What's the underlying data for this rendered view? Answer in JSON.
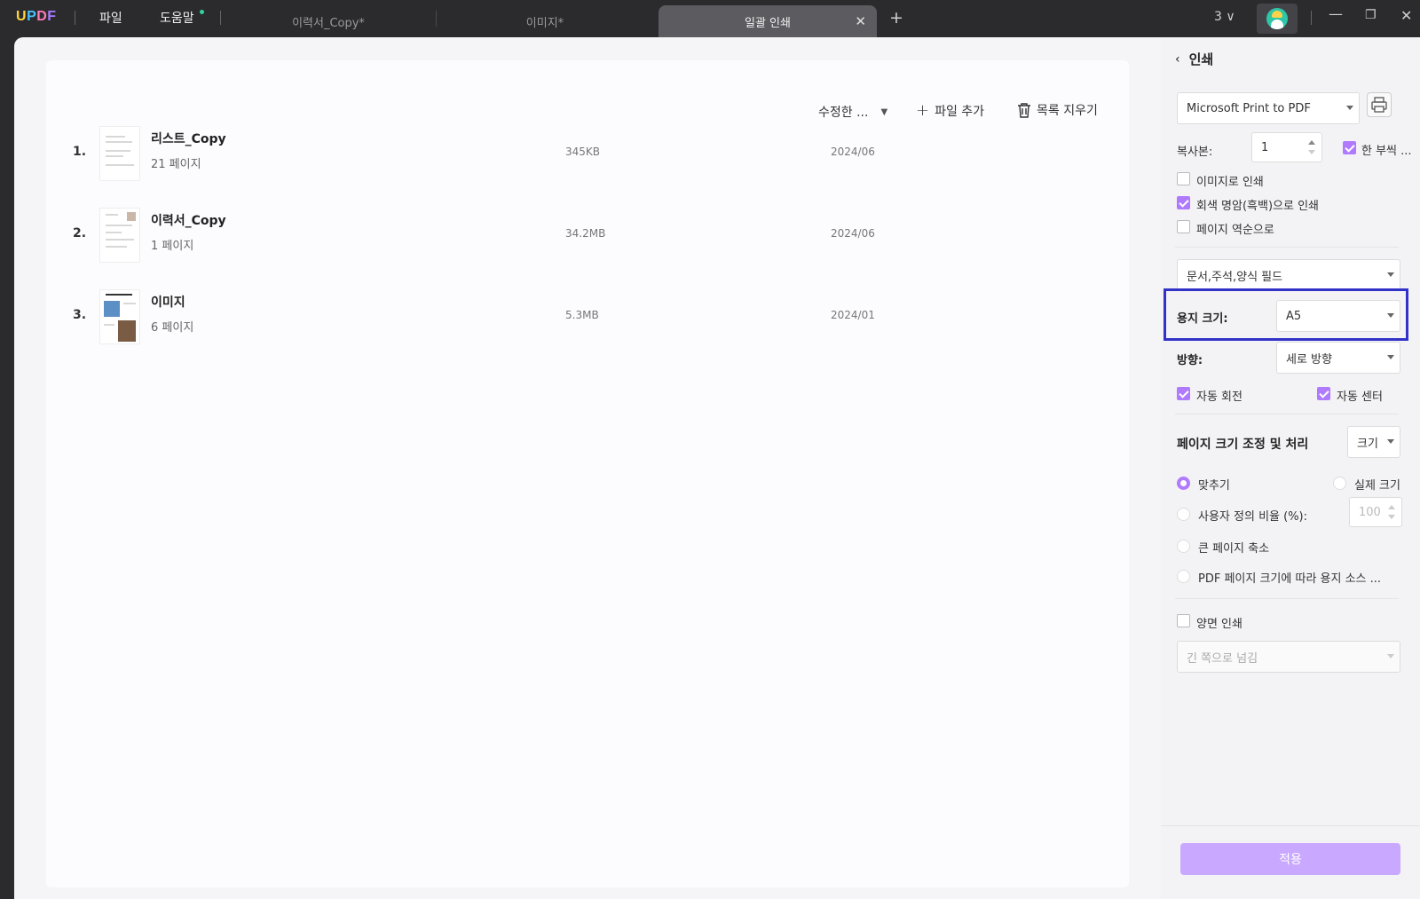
{
  "titlebar": {
    "logo": "UPDF",
    "menu_file": "파일",
    "menu_help": "도움말",
    "tabs": [
      {
        "label": "이력서_Copy*"
      },
      {
        "label": "이미지*"
      },
      {
        "label": "일괄 인쇄"
      }
    ],
    "active_tab_close": "✕",
    "new_tab": "+",
    "account_count": "3"
  },
  "toolbar": {
    "sort_label": "수정한 ...",
    "add_file_label": "파일 추가",
    "clear_list_label": "목록 지우기"
  },
  "files": [
    {
      "index": "1.",
      "name": "리스트_Copy",
      "pages": "21 페이지",
      "size": "345KB",
      "date": "2024/06"
    },
    {
      "index": "2.",
      "name": "이력서_Copy",
      "pages": "1 페이지",
      "size": "34.2MB",
      "date": "2024/06"
    },
    {
      "index": "3.",
      "name": "이미지",
      "pages": "6 페이지",
      "size": "5.3MB",
      "date": "2024/01"
    }
  ],
  "panel": {
    "title": "인쇄",
    "printer": "Microsoft Print to PDF",
    "copies_label": "복사본:",
    "copies_value": "1",
    "collate_label": "한 부씩 ...",
    "collate_checked": true,
    "print_as_image_label": "이미지로 인쇄",
    "print_as_image_checked": false,
    "grayscale_label": "회색 명암(흑백)으로 인쇄",
    "grayscale_checked": true,
    "reverse_label": "페이지 역순으로",
    "reverse_checked": false,
    "content_select": "문서,주석,양식 필드",
    "paper_size_label": "용지 크기:",
    "paper_size_value": "A5",
    "orientation_label": "방향:",
    "orientation_value": "세로 방향",
    "auto_rotate_label": "자동 회전",
    "auto_rotate_checked": true,
    "auto_center_label": "자동 센터",
    "auto_center_checked": true,
    "scaling_title": "페이지 크기 조정 및 처리",
    "scaling_mode": "크기",
    "fit_label": "맞추기",
    "actual_size_label": "실제 크기",
    "custom_scale_label": "사용자 정의 비율 (%):",
    "custom_scale_value": "100",
    "shrink_label": "큰 페이지 축소",
    "pdf_source_label": "PDF 페이지 크기에 따라 용지 소스 ...",
    "selected_scaling": "맞추기",
    "duplex_label": "양면 인쇄",
    "duplex_checked": false,
    "flip_select": "긴 쪽으로 넘김",
    "apply_label": "적용"
  },
  "colors": {
    "accent": "#b07aff",
    "apply_button": "#c9a8ff",
    "highlight_box": "#3232c8",
    "titlebar": "#2b2b2e"
  }
}
